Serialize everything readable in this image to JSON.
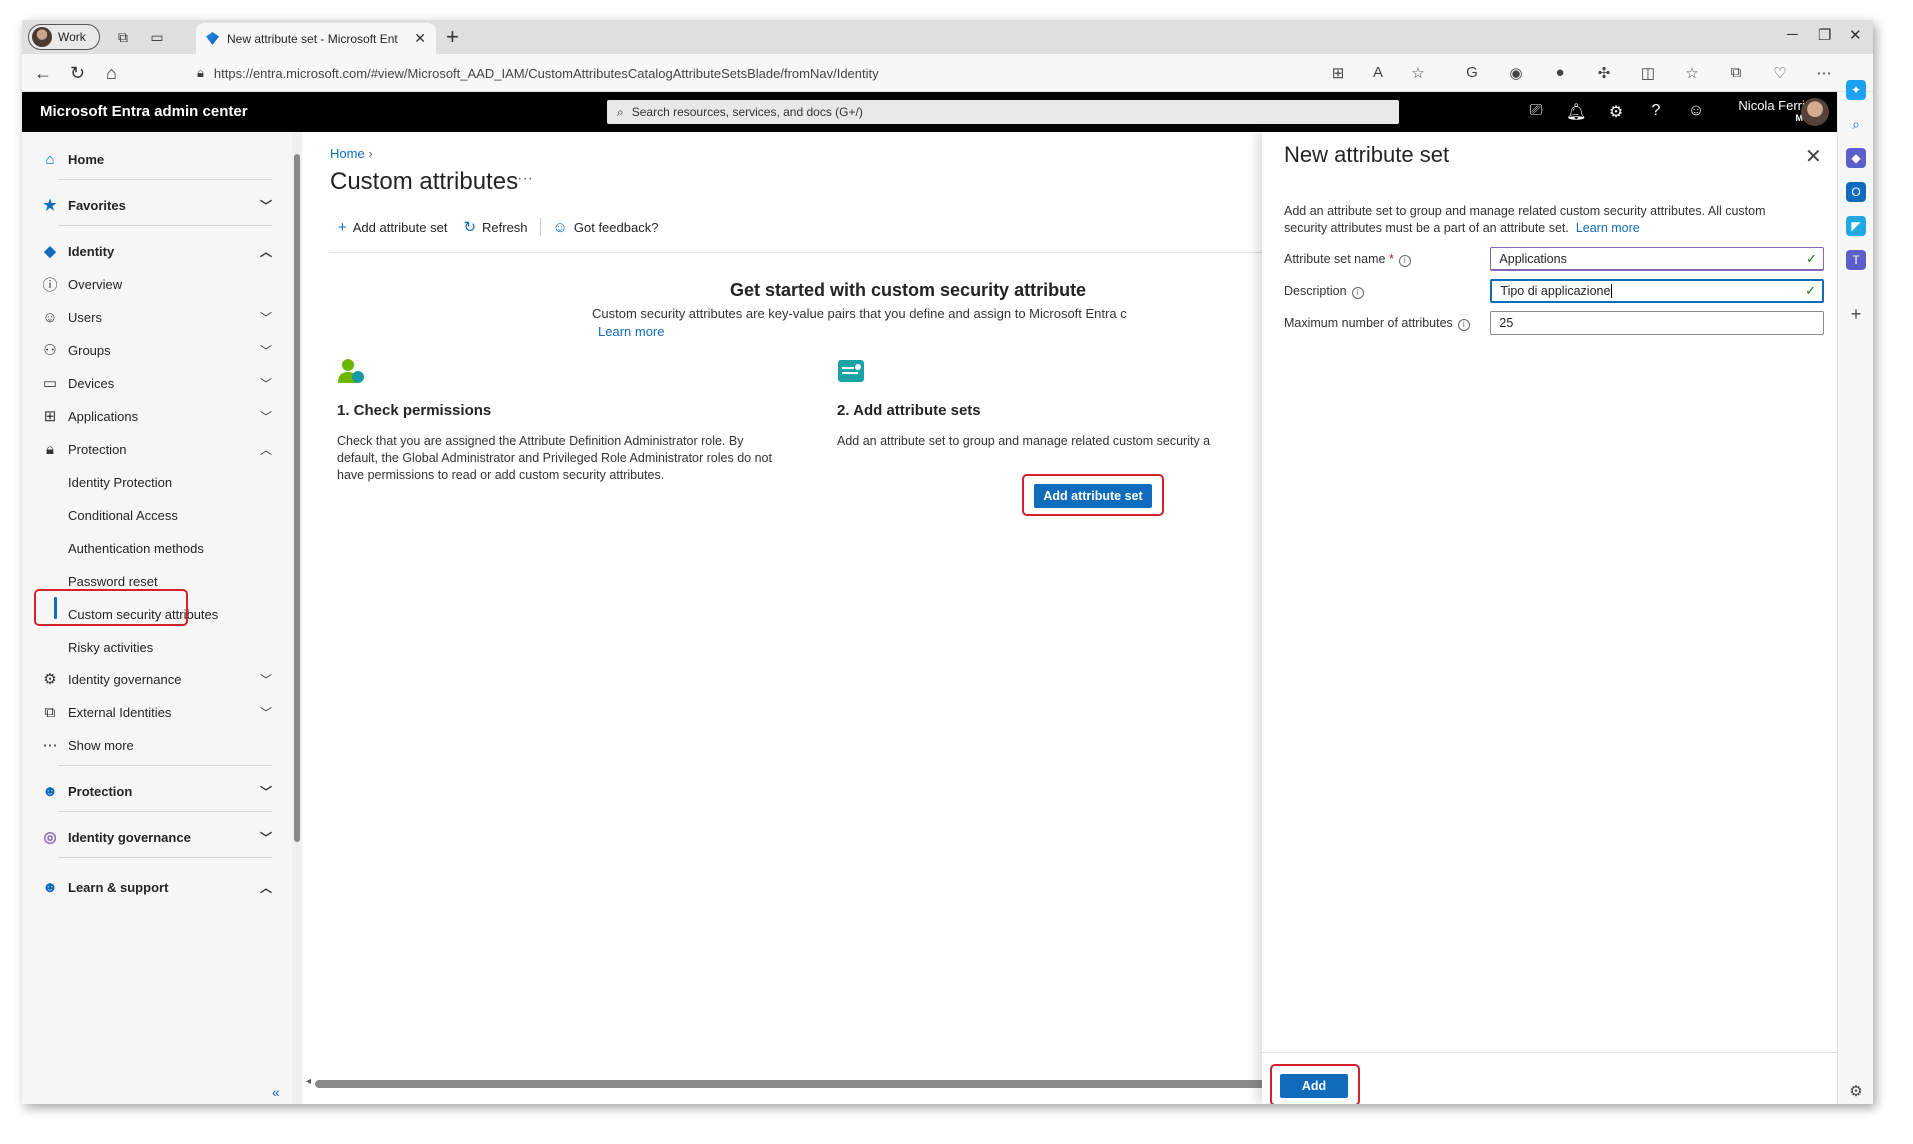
{
  "browser": {
    "profile_label": "Work",
    "tab_title": "New attribute set - Microsoft Ent",
    "url": "https://entra.microsoft.com/#view/Microsoft_AAD_IAM/CustomAttributesCatalogAttributeSetsBlade/fromNav/Identity"
  },
  "header": {
    "brand": "Microsoft Entra admin center",
    "search_placeholder": "Search resources, services, and docs (G+/)",
    "user_name": "Nicola Ferrini",
    "user_badge": "MVP"
  },
  "nav": {
    "home": "Home",
    "favorites": "Favorites",
    "identity": "Identity",
    "overview": "Overview",
    "users": "Users",
    "groups": "Groups",
    "devices": "Devices",
    "applications": "Applications",
    "protection": "Protection",
    "identity_protection": "Identity Protection",
    "conditional_access": "Conditional Access",
    "authentication_methods": "Authentication methods",
    "password_reset": "Password reset",
    "custom_security_attributes": "Custom security attributes",
    "risky_activities": "Risky activities",
    "identity_governance": "Identity governance",
    "external_identities": "External Identities",
    "show_more": "Show more",
    "protection_section": "Protection",
    "identity_governance_section": "Identity governance",
    "learn_support": "Learn & support"
  },
  "content": {
    "breadcrumb": "Home",
    "title": "Custom attributes",
    "commands": {
      "add": "Add attribute set",
      "refresh": "Refresh",
      "feedback": "Got feedback?"
    },
    "get_started_title": "Get started with custom security attribute",
    "get_started_desc": "Custom security attributes are key-value pairs that you define and assign to Microsoft Entra c",
    "learn_more": "Learn more",
    "step1_title": "1. Check permissions",
    "step1_text": "Check that you are assigned the Attribute Definition Administrator role. By default, the Global Administrator and Privileged Role Administrator roles do not have permissions to read or add custom security attributes.",
    "step2_title": "2. Add attribute sets",
    "step2_text": "Add an attribute set to group and manage related custom security a",
    "add_button": "Add attribute set"
  },
  "blade": {
    "title": "New attribute set",
    "description": "Add an attribute set to group and manage related custom security attributes. All custom security attributes must be a part of an attribute set.",
    "learn_more": "Learn more",
    "name_label": "Attribute set name",
    "name_required": "*",
    "name_value": "Applications",
    "desc_label": "Description",
    "desc_value": "Tipo di applicazione",
    "max_label": "Maximum number of attributes",
    "max_value": "25",
    "add_button": "Add"
  }
}
